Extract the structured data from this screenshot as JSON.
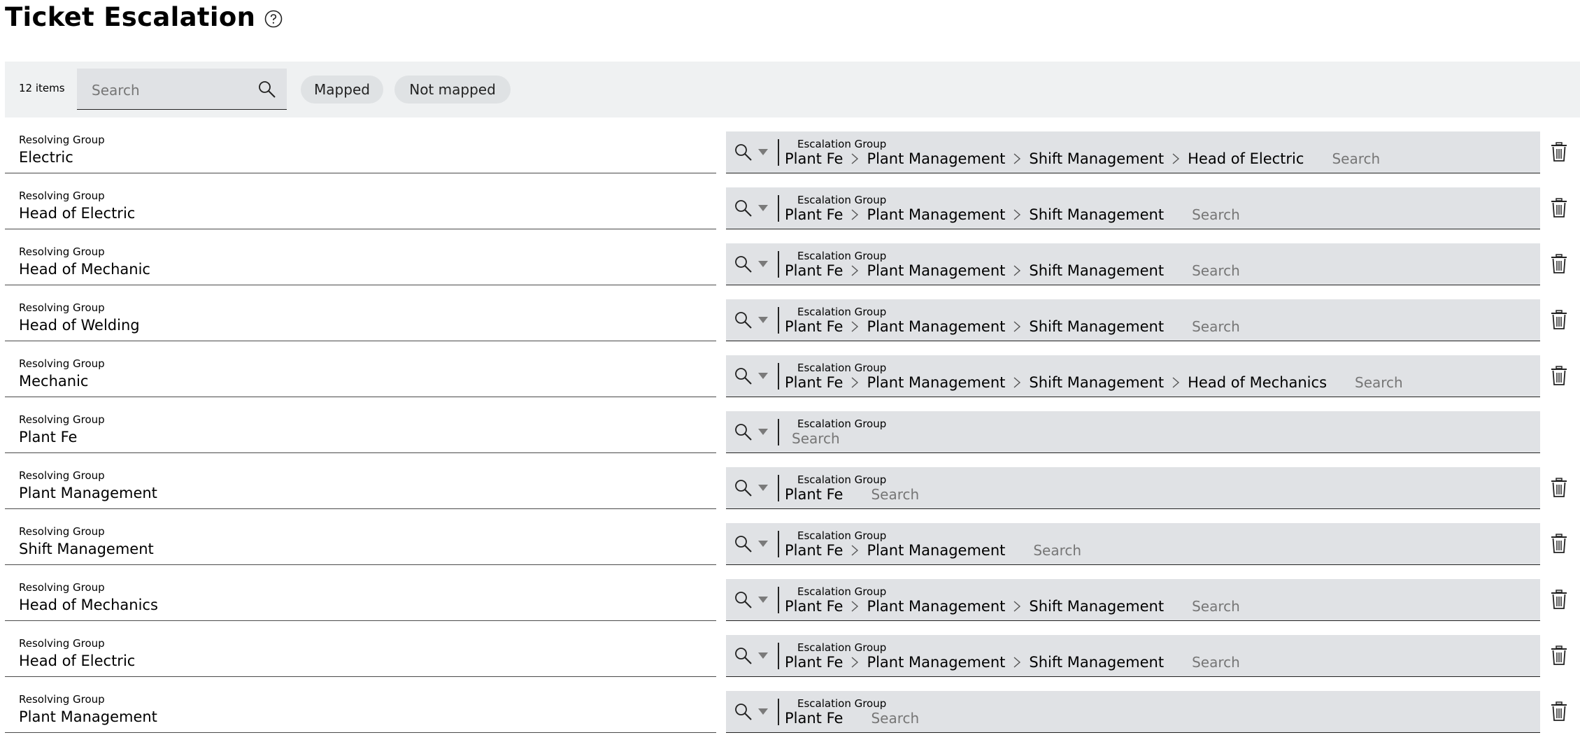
{
  "page": {
    "title": "Ticket Escalation"
  },
  "toolbar": {
    "item_count": "12 items",
    "search_placeholder": "Search",
    "filters": {
      "mapped": "Mapped",
      "not_mapped": "Not mapped"
    }
  },
  "icons": {
    "help": "help-icon",
    "search": "search-icon",
    "delete": "trash-icon",
    "caret": "caret-down-icon",
    "breadcrumb_separator": "chevron-right-icon"
  },
  "colors": {
    "toolbar_bg": "#eff1f2",
    "field_bg": "#e0e2e5",
    "placeholder": "#767676"
  },
  "field_labels": {
    "resolving": "Resolving Group",
    "escalation": "Escalation Group",
    "search": "Search"
  },
  "rows": [
    {
      "resolving": "Electric",
      "path": [
        "Plant Fe",
        "Plant Management",
        "Shift Management",
        "Head of Electric"
      ],
      "deletable": true
    },
    {
      "resolving": "Head of Electric",
      "path": [
        "Plant Fe",
        "Plant Management",
        "Shift Management"
      ],
      "deletable": true
    },
    {
      "resolving": "Head of Mechanic",
      "path": [
        "Plant Fe",
        "Plant Management",
        "Shift Management"
      ],
      "deletable": true
    },
    {
      "resolving": "Head of Welding",
      "path": [
        "Plant Fe",
        "Plant Management",
        "Shift Management"
      ],
      "deletable": true
    },
    {
      "resolving": "Mechanic",
      "path": [
        "Plant Fe",
        "Plant Management",
        "Shift Management",
        "Head of Mechanics"
      ],
      "deletable": true
    },
    {
      "resolving": "Plant Fe",
      "path": [],
      "deletable": false
    },
    {
      "resolving": "Plant Management",
      "path": [
        "Plant Fe"
      ],
      "deletable": true
    },
    {
      "resolving": "Shift Management",
      "path": [
        "Plant Fe",
        "Plant Management"
      ],
      "deletable": true
    },
    {
      "resolving": "Head of Mechanics",
      "path": [
        "Plant Fe",
        "Plant Management",
        "Shift Management"
      ],
      "deletable": true
    },
    {
      "resolving": "Head of Electric",
      "path": [
        "Plant Fe",
        "Plant Management",
        "Shift Management"
      ],
      "deletable": true
    },
    {
      "resolving": "Plant Management",
      "path": [
        "Plant Fe"
      ],
      "deletable": true
    }
  ]
}
